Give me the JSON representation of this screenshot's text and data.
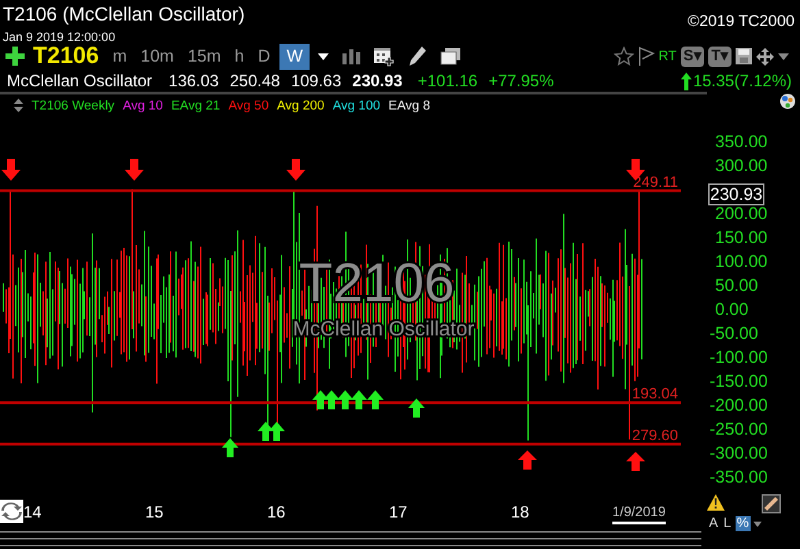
{
  "window": {
    "title": "T2106 (McClellan Oscillator)",
    "datetime": "Jan 9 2019 12:00:00",
    "copyright": "©2019 TC2000"
  },
  "toolbar": {
    "symbol": "T2106",
    "timeframes": [
      {
        "label": "m",
        "selected": false
      },
      {
        "label": "10m",
        "selected": false
      },
      {
        "label": "15m",
        "selected": false
      },
      {
        "label": "h",
        "selected": false
      },
      {
        "label": "D",
        "selected": false
      },
      {
        "label": "W",
        "selected": true
      }
    ],
    "rt": "RT",
    "buttons": [
      "S▾",
      "T▾"
    ]
  },
  "quote": {
    "name": "McClellan Oscillator",
    "open": "136.03",
    "high": "250.48",
    "low": "109.63",
    "last": "230.93",
    "change": "+101.16",
    "change_percent": "+77.95%",
    "period_change": "15.35(7.12%)"
  },
  "legend": [
    {
      "label": "T2106 Weekly",
      "color": "#22dd22"
    },
    {
      "label": "Avg 10",
      "color": "#e020e0"
    },
    {
      "label": "EAvg 21",
      "color": "#22dd22"
    },
    {
      "label": "Avg 50",
      "color": "#ff1010"
    },
    {
      "label": "Avg 200",
      "color": "#f0f000"
    },
    {
      "label": "Avg 100",
      "color": "#20e0e0"
    },
    {
      "label": "EAvg 8",
      "color": "#f0f0f0"
    }
  ],
  "chart": {
    "watermark_symbol": "T2106",
    "watermark_name": "McClellan Oscillator",
    "levels": [
      "249.11",
      "193.04",
      "279.60"
    ],
    "markers": [
      {
        "kind": "sell"
      },
      {
        "kind": "sell"
      },
      {
        "kind": "buy"
      },
      {
        "kind": "buy"
      },
      {
        "kind": "buy"
      },
      {
        "kind": "sell"
      },
      {
        "kind": "buy"
      },
      {
        "kind": "buy"
      },
      {
        "kind": "buy"
      },
      {
        "kind": "buy"
      },
      {
        "kind": "buy"
      },
      {
        "kind": "buy"
      },
      {
        "kind": "bottom"
      },
      {
        "kind": "sell"
      },
      {
        "kind": "bottom"
      }
    ],
    "y_ticks": [
      "350.00",
      "300.00",
      "200.00",
      "150.00",
      "100.00",
      "50.00",
      "0.00",
      "-50.00",
      "-100.00",
      "-150.00",
      "-200.00",
      "-250.00",
      "-300.00",
      "-350.00"
    ],
    "last_price": "230.93",
    "x_labels": [
      "14",
      "15",
      "16",
      "17",
      "18"
    ],
    "date_label": "1/9/2019",
    "scale_modes": [
      {
        "label": "A",
        "selected": false
      },
      {
        "label": "L",
        "selected": false
      },
      {
        "label": "%",
        "selected": true
      }
    ]
  }
}
